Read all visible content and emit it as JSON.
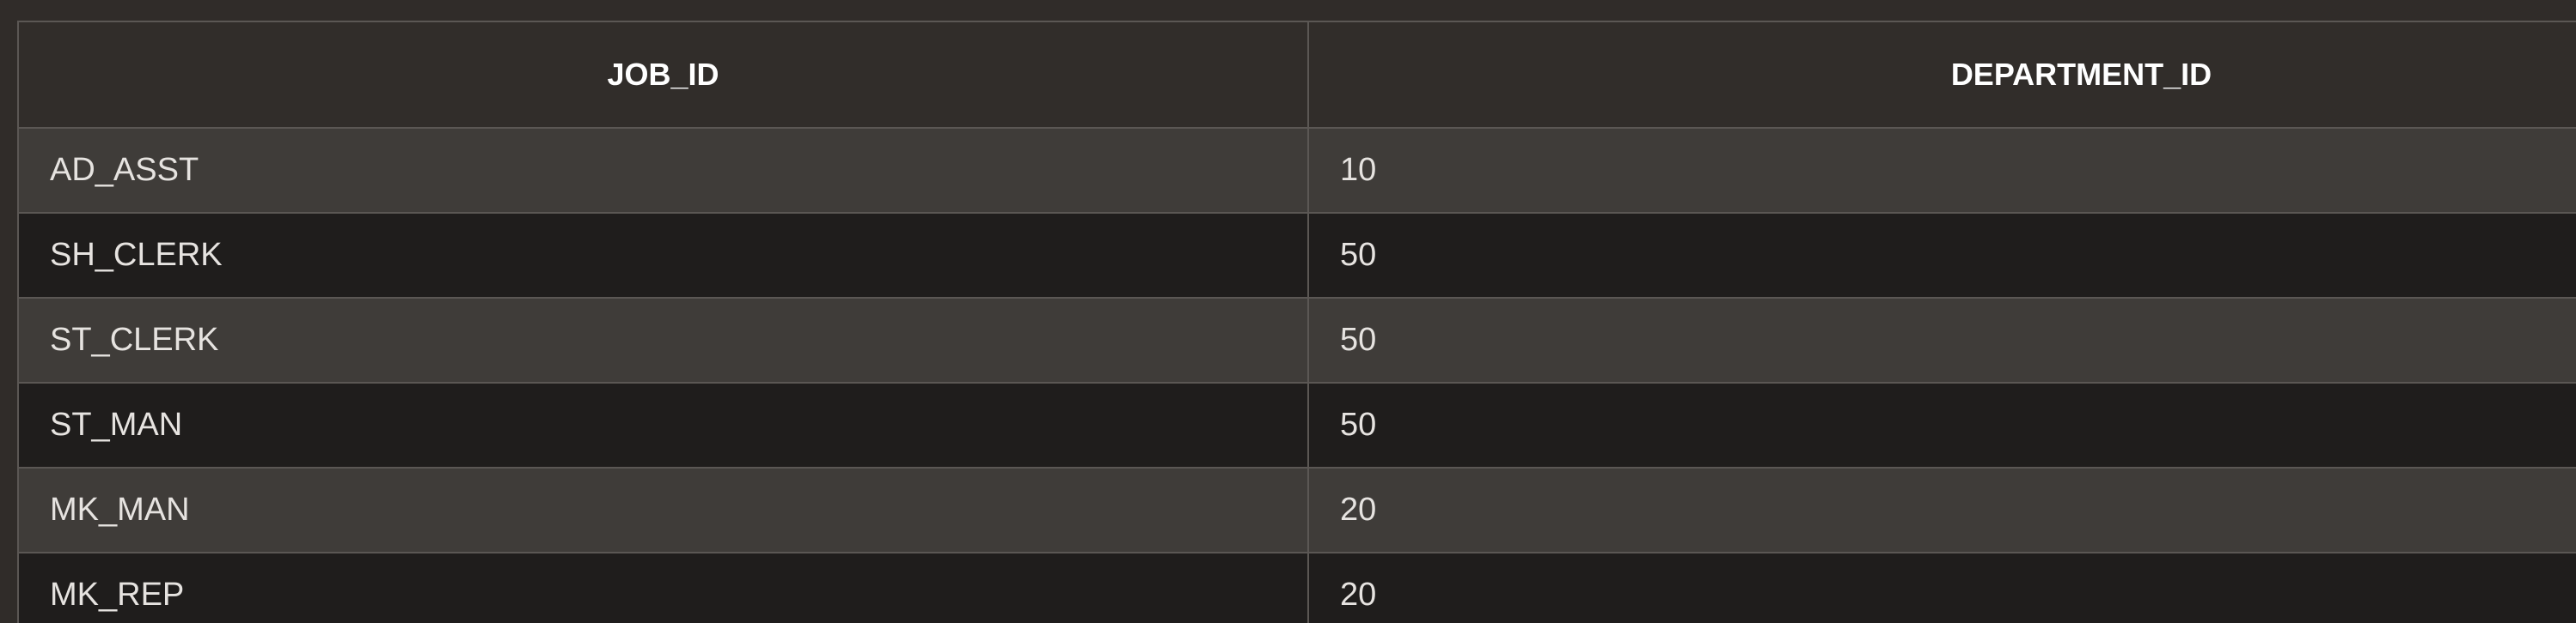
{
  "table": {
    "headers": [
      "JOB_ID",
      "DEPARTMENT_ID"
    ],
    "rows": [
      [
        "AD_ASST",
        "10"
      ],
      [
        "SH_CLERK",
        "50"
      ],
      [
        "ST_CLERK",
        "50"
      ],
      [
        "ST_MAN",
        "50"
      ],
      [
        "MK_MAN",
        "20"
      ],
      [
        "MK_REP",
        "20"
      ]
    ]
  },
  "colors": {
    "page_background": "#302c29",
    "header_background": "#312d2a",
    "row_odd": "#3f3c39",
    "row_even": "#1f1d1c",
    "border": "#5b5754",
    "header_text": "#ffffff",
    "cell_text": "#e6e3e0"
  }
}
